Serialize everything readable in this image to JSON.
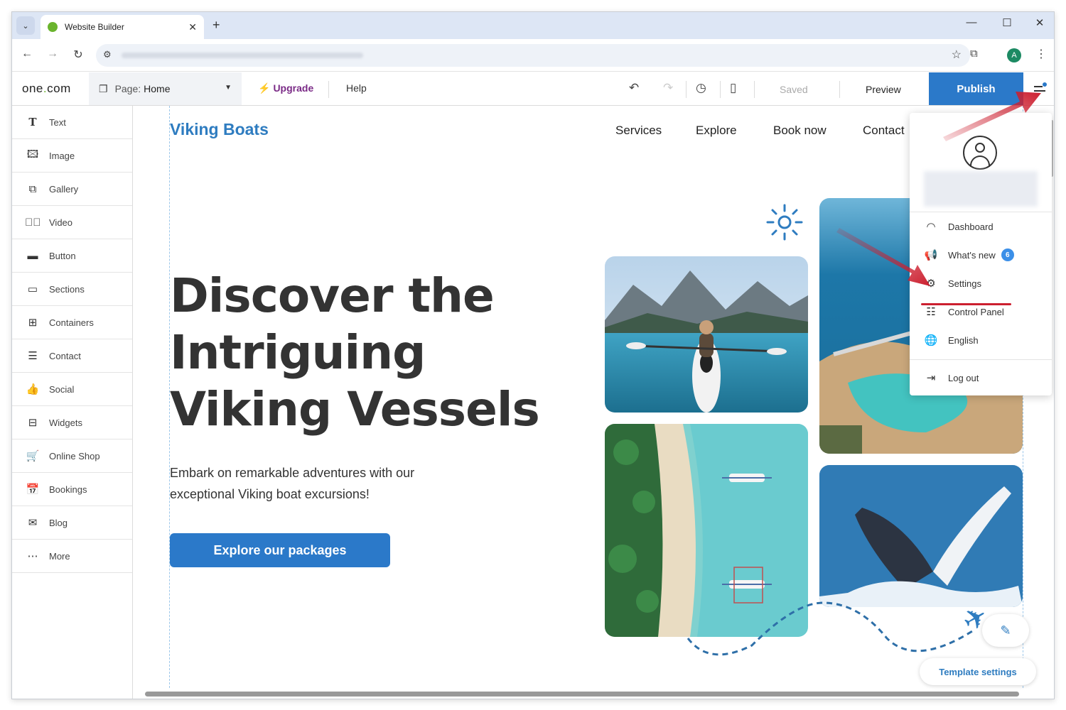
{
  "browser": {
    "tab_title": "Website Builder",
    "new_tab": "+",
    "controls": {
      "minimize": "—",
      "maximize": "☐",
      "close": "✕"
    },
    "profile_initial": "A"
  },
  "toolbar": {
    "logo_a": "one",
    "logo_dot": ".",
    "logo_b": "com",
    "page_label": "Page:",
    "page_value": "Home",
    "upgrade": "Upgrade",
    "help": "Help",
    "saved": "Saved",
    "preview": "Preview",
    "publish": "Publish"
  },
  "sidebar": {
    "items": [
      {
        "label": "Text",
        "icon": "text-icon"
      },
      {
        "label": "Image",
        "icon": "image-icon"
      },
      {
        "label": "Gallery",
        "icon": "gallery-icon"
      },
      {
        "label": "Video",
        "icon": "video-icon"
      },
      {
        "label": "Button",
        "icon": "button-icon"
      },
      {
        "label": "Sections",
        "icon": "sections-icon"
      },
      {
        "label": "Containers",
        "icon": "containers-icon"
      },
      {
        "label": "Contact",
        "icon": "contact-icon"
      },
      {
        "label": "Social",
        "icon": "social-icon"
      },
      {
        "label": "Widgets",
        "icon": "widgets-icon"
      },
      {
        "label": "Online Shop",
        "icon": "cart-icon"
      },
      {
        "label": "Bookings",
        "icon": "bookings-icon"
      },
      {
        "label": "Blog",
        "icon": "blog-icon"
      },
      {
        "label": "More",
        "icon": "more-icon"
      }
    ]
  },
  "site": {
    "brand": "Viking Boats",
    "nav": [
      "Services",
      "Explore",
      "Book now",
      "Contact"
    ],
    "hero_line1": "Discover the",
    "hero_line2": "Intriguing",
    "hero_line3": "Viking Vessels",
    "hero_sub": "Embark on remarkable adventures with our exceptional Viking boat excursions!",
    "cta": "Explore our packages",
    "template_settings": "Template settings"
  },
  "menu": {
    "dashboard": "Dashboard",
    "whats_new": "What's new",
    "whats_new_count": "6",
    "settings": "Settings",
    "control_panel": "Control Panel",
    "language": "English",
    "logout": "Log out"
  },
  "colors": {
    "accent": "#2b79c9",
    "upgrade": "#7a2a86",
    "annotation": "#cc1f2f"
  }
}
